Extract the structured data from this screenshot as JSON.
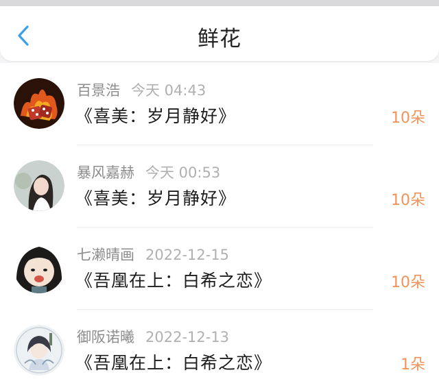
{
  "header": {
    "title": "鲜花"
  },
  "colors": {
    "accent_blue": "#3aa0e8",
    "count_orange": "#f0935a"
  },
  "records": [
    {
      "user": "百景浩",
      "time": "今天 04:43",
      "gift": "《喜美：岁月静好》",
      "count": "10朵",
      "avatar": "flaming-dice-avatar"
    },
    {
      "user": "暴风嘉赫",
      "time": "今天 00:53",
      "gift": "《喜美：岁月静好》",
      "count": "10朵",
      "avatar": "girl-photo-avatar"
    },
    {
      "user": "七濑晴画",
      "time": "2022-12-15",
      "gift": "《吾凰在上：白希之恋》",
      "count": "10朵",
      "avatar": "cartoon-girl-avatar"
    },
    {
      "user": "御阪诺曦",
      "time": "2022-12-13",
      "gift": "《吾凰在上：白希之恋》",
      "count": "1朵",
      "avatar": "chibi-character-avatar"
    }
  ]
}
